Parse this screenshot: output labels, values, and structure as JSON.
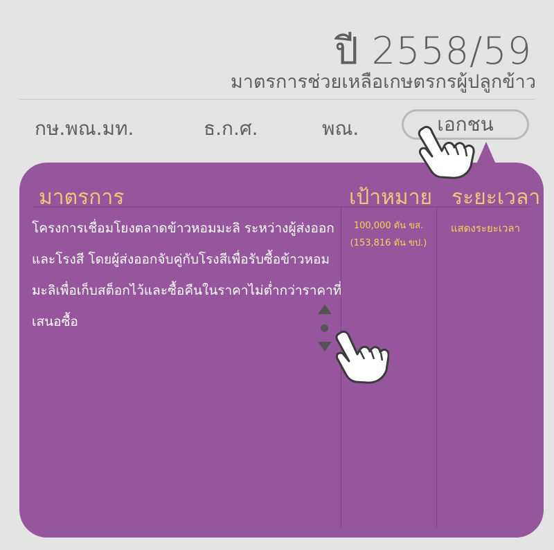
{
  "header": {
    "year": "ปี 2558/59",
    "subtitle": "มาตรการช่วยเหลือเกษตรกรผู้ปลูกข้าว"
  },
  "tabs": [
    {
      "label": "กษ.พณ.มท.",
      "active": false
    },
    {
      "label": "ธ.ก.ศ.",
      "active": false
    },
    {
      "label": "พณ.",
      "active": false
    },
    {
      "label": "เอกชน",
      "active": true
    }
  ],
  "table": {
    "headers": {
      "measure": "มาตรการ",
      "target": "เป้าหมาย",
      "period": "ระยะเวลา"
    },
    "row": {
      "measure": "โครงการเชื่อมโยงตลาดข้าวหอมมะลิ ระหว่างผู้ส่งออกและโรงสี โดยผู้ส่งออกจับคู่กับโรงสีเพื่อรับซื้อข้าวหอมมะลิเพื่อเก็บสต็อกไว้และซื้อคืนในราคาไม่ต่ำกว่าราคาที่เสนอซื้อ",
      "target_line1": "100,000 ตัน ขส.",
      "target_line2": "(153,816 ตัน ขป.)",
      "period": "แสดงระยะเวลา"
    }
  },
  "scroll": {
    "up_icon": "arrow-up-icon",
    "dot_icon": "dot-icon",
    "down_icon": "arrow-down-icon"
  },
  "colors": {
    "panel": "#95569c",
    "header_text": "#f1c57b",
    "highlight_text": "#f6d35a",
    "background": "#e4e4e4",
    "heading_text": "#5f5f5f"
  },
  "icons": {
    "tab_pointer": "hand-pointer-icon",
    "scroll_pointer": "hand-pointer-icon"
  }
}
